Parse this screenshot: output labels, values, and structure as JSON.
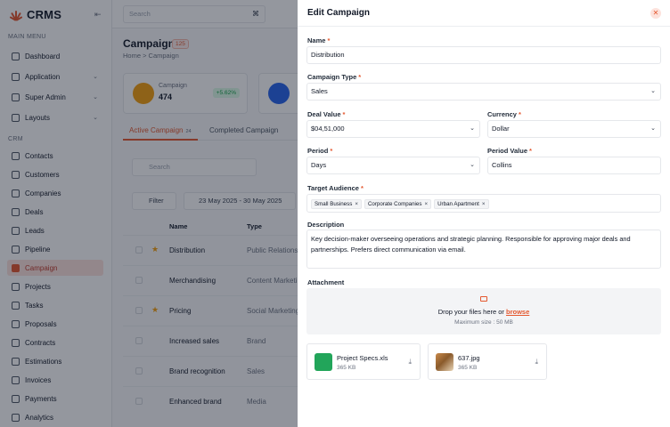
{
  "sidebar": {
    "logo": "CRMS",
    "main_menu_title": "MAIN MENU",
    "main_items": [
      {
        "label": "Dashboard"
      },
      {
        "label": "Application"
      },
      {
        "label": "Super Admin"
      },
      {
        "label": "Layouts"
      }
    ],
    "crm_title": "CRM",
    "crm_items": [
      {
        "label": "Contacts"
      },
      {
        "label": "Customers"
      },
      {
        "label": "Companies"
      },
      {
        "label": "Deals"
      },
      {
        "label": "Leads"
      },
      {
        "label": "Pipeline"
      },
      {
        "label": "Campaign"
      },
      {
        "label": "Projects"
      },
      {
        "label": "Tasks"
      },
      {
        "label": "Proposals"
      },
      {
        "label": "Contracts"
      },
      {
        "label": "Estimations"
      },
      {
        "label": "Invoices"
      },
      {
        "label": "Payments"
      },
      {
        "label": "Analytics"
      }
    ]
  },
  "topbar": {
    "search_placeholder": "Search",
    "search_kbd": "⌘"
  },
  "page": {
    "title": "Campaign",
    "count": "125",
    "breadcrumb": "Home  >  Campaign",
    "stat": {
      "label": "Campaign",
      "value": "474",
      "change": "+5.62%"
    },
    "tabs": [
      {
        "label": "Active Campaign",
        "count": "24"
      },
      {
        "label": "Completed Campaign"
      }
    ],
    "list_search_placeholder": "Search",
    "filter_label": "Filter",
    "date_range": "23 May 2025 - 30 May 2025",
    "columns": {
      "name": "Name",
      "type": "Type"
    },
    "rows": [
      {
        "name": "Distribution",
        "type": "Public Relations",
        "star": "★"
      },
      {
        "name": "Merchandising",
        "type": "Content Marketing",
        "star": ""
      },
      {
        "name": "Pricing",
        "type": "Social Marketing",
        "star": "★"
      },
      {
        "name": "Increased sales",
        "type": "Brand",
        "star": ""
      },
      {
        "name": "Brand recognition",
        "type": "Sales",
        "star": ""
      },
      {
        "name": "Enhanced brand",
        "type": "Media",
        "star": ""
      }
    ]
  },
  "drawer": {
    "title": "Edit Campaign",
    "close_icon": "✕",
    "fields": {
      "name": {
        "label": "Name",
        "value": "Distribution"
      },
      "campaign_type": {
        "label": "Campaign Type",
        "value": "Sales"
      },
      "deal_value": {
        "label": "Deal Value",
        "value": "$04,51,000"
      },
      "currency": {
        "label": "Currency",
        "value": "Dollar"
      },
      "period": {
        "label": "Period",
        "value": "Days"
      },
      "period_value": {
        "label": "Period Value",
        "value": "Collins"
      },
      "target_audience": {
        "label": "Target Audience",
        "tags": [
          "Small Business",
          "Corporate Companies",
          "Urban Apartment"
        ]
      },
      "description": {
        "label": "Description",
        "value": "Key decision-maker overseeing operations and strategic planning. Responsible for approving major deals and partnerships. Prefers direct communication via email."
      }
    },
    "attachment": {
      "label": "Attachment",
      "drop_text": "Drop your files here or",
      "browse": "browse",
      "max_size": "Maximum size : 50 MB",
      "files": [
        {
          "name": "Project Specs.xls",
          "size": "365 KB"
        },
        {
          "name": "637.jpg",
          "size": "365 KB"
        }
      ]
    },
    "required_mark": "*",
    "accent_color": "#e4572e"
  }
}
